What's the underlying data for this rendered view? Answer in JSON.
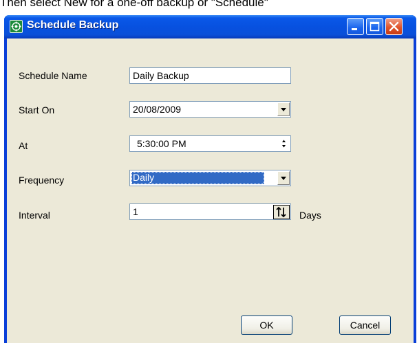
{
  "caption": "Then select New for a one-off backup or \"Schedule\"",
  "window": {
    "title": "Schedule Backup"
  },
  "form": {
    "schedule_name": {
      "label": "Schedule Name",
      "value": "Daily Backup"
    },
    "start_on": {
      "label": "Start On",
      "value": "20/08/2009"
    },
    "at": {
      "label": "At",
      "value": "5:30:00 PM"
    },
    "frequency": {
      "label": "Frequency",
      "value": "Daily"
    },
    "interval": {
      "label": "Interval",
      "value": "1",
      "unit": "Days"
    }
  },
  "buttons": {
    "ok": "OK",
    "cancel": "Cancel"
  },
  "colors": {
    "titlebar": "#0a58e8",
    "client": "#ece9d8",
    "selection": "#316ac5",
    "close": "#e0552d"
  },
  "icons": {
    "app": "green-target-icon",
    "minimize": "minimize-icon",
    "maximize": "maximize-icon",
    "close": "close-icon"
  }
}
